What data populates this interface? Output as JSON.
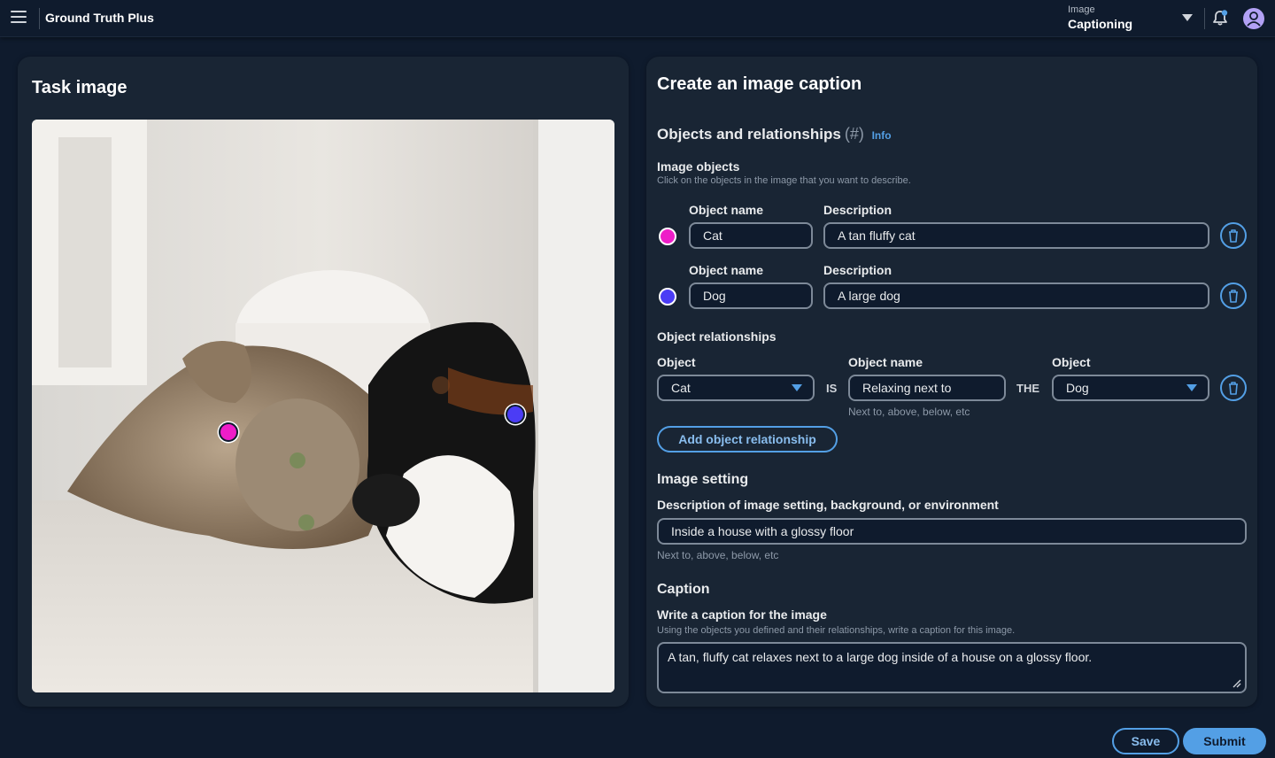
{
  "header": {
    "app_title": "Ground Truth Plus",
    "task_type_label": "Image",
    "task_type_value": "Captioning",
    "icons": [
      "menu-icon",
      "caret-down-icon",
      "bell-icon",
      "user-avatar-icon"
    ]
  },
  "left_panel": {
    "title": "Task image",
    "image_description_icon": "cat-and-dog-photo",
    "markers": [
      {
        "object": "Cat",
        "color": "#ee1dc8"
      },
      {
        "object": "Dog",
        "color": "#4b3cf5"
      }
    ]
  },
  "right_panel": {
    "title": "Create an image caption",
    "objects_relationships": {
      "heading": "Objects and relationships",
      "count_label": "(#)",
      "info_link": "Info"
    },
    "image_objects": {
      "heading": "Image objects",
      "hint": "Click on the objects in the image that you want to describe.",
      "items": [
        {
          "color": "#ee1dc8",
          "name_label": "Object name",
          "name_value": "Cat",
          "desc_label": "Description",
          "desc_value": "A tan fluffy cat"
        },
        {
          "color": "#4b3cf5",
          "name_label": "Object name",
          "name_value": "Dog",
          "desc_label": "Description",
          "desc_value": "A large dog"
        }
      ]
    },
    "object_relationships": {
      "heading": "Object relationships",
      "subject_label": "Object",
      "subject_value": "Cat",
      "is_label": "IS",
      "relation_label": "Object name",
      "relation_value": "Relaxing next to",
      "relation_hint": "Next to, above, below, etc",
      "the_label": "THE",
      "target_label": "Object",
      "target_value": "Dog",
      "add_button": "Add object relationship"
    },
    "image_setting": {
      "heading": "Image setting",
      "field_label": "Description of image setting, background, or environment",
      "value": "Inside a house with a glossy floor",
      "hint": "Next to, above, below, etc"
    },
    "caption": {
      "heading": "Caption",
      "field_label": "Write a caption for the image",
      "hint": "Using the objects you defined and their relationships, write a caption for this image.",
      "value": "A tan, fluffy cat relaxes next to a large dog inside of a house on a glossy floor."
    }
  },
  "footer": {
    "save_label": "Save",
    "submit_label": "Submit"
  },
  "colors": {
    "background": "#0f1b2d",
    "panel": "#192534",
    "accent": "#539fe5",
    "cat_marker": "#ee1dc8",
    "dog_marker": "#4b3cf5"
  }
}
